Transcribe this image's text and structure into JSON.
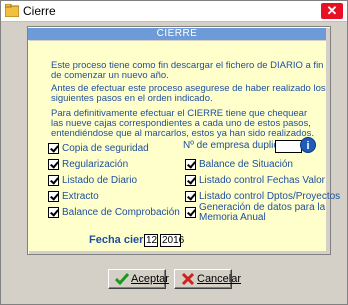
{
  "window": {
    "title": "Cierre"
  },
  "panel": {
    "header": "CIERRE"
  },
  "info": {
    "p1": "Este proceso tiene como fin descargar el fichero de DIARIO a fin de comenzar un nuevo año.",
    "p2": "Antes de efectuar este proceso asegurese de haber realizado los siguientes pasos en el orden indicado.",
    "p3": "Para definitivamente efectuar el CIERRE  tiene que chequear las nueve cajas correspondientes a cada uno de estos pasos, entendiéndose que al marcarlos, estos ya han sido realizados."
  },
  "checks_left": [
    {
      "label": "Copia de seguridad",
      "checked": true
    },
    {
      "label": "Regularización",
      "checked": true
    },
    {
      "label": "Listado de Diario",
      "checked": true
    },
    {
      "label": "Extracto",
      "checked": true
    },
    {
      "label": "Balance de Comprobación",
      "checked": true
    }
  ],
  "checks_right": [
    {
      "label": "Balance de Situación",
      "checked": true
    },
    {
      "label": "Listado control Fechas Valor",
      "checked": true
    },
    {
      "label": "Listado control Dptos/Proyectos",
      "checked": true
    },
    {
      "label": "Generación de datos para la",
      "label2": "Memoria Anual",
      "checked": true
    }
  ],
  "empresa": {
    "label": "Nº de empresa duplicada",
    "value": "",
    "info_icon": "info-icon"
  },
  "fecha": {
    "label": "Fecha cierre",
    "day": "12",
    "year": "2016"
  },
  "buttons": {
    "accept": "Aceptar",
    "cancel": "Cancelar"
  },
  "colors": {
    "accent": "#6c9bd8",
    "panel_bg": "#ffffcc",
    "text": "#1e4f9e",
    "close": "#e81123"
  }
}
